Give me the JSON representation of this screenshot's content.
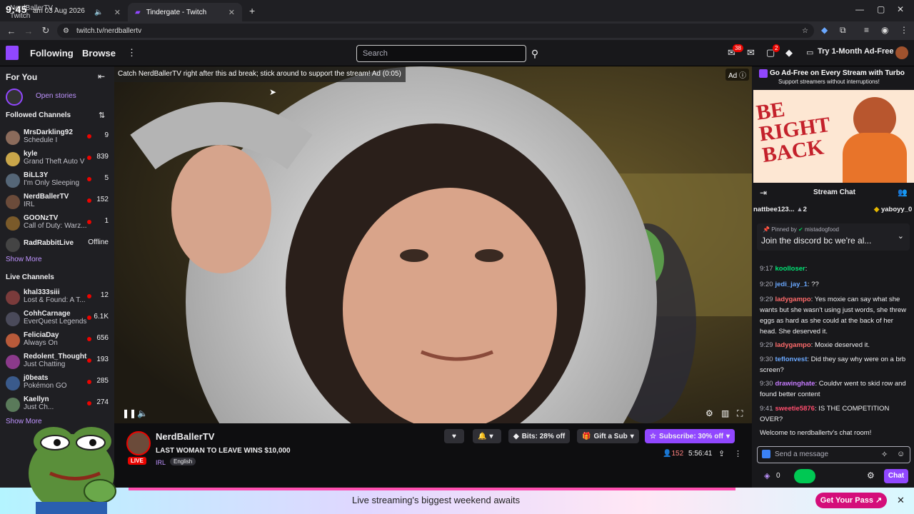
{
  "browser": {
    "clock": "9:45",
    "date": "am  03 Aug 2026",
    "tabs": [
      {
        "label": "NerdBallerTV - Twitch",
        "active": false
      },
      {
        "label": "Tindergate - Twitch",
        "active": true
      }
    ],
    "url": "twitch.tv/nerdballertv"
  },
  "nav": {
    "following": "Following",
    "browse": "Browse",
    "search_placeholder": "Search",
    "inbox_badge": "38",
    "notif_badge": "2",
    "try_turbo": "Try 1-Month Ad-Free"
  },
  "sidebar": {
    "for_you": "For You",
    "open_stories": "Open stories",
    "followed_header": "Followed Channels",
    "followed": [
      {
        "name": "MrsDarkling92",
        "game": "Schedule I",
        "viewers": "9",
        "color": "#8b6b5b"
      },
      {
        "name": "kyle",
        "game": "Grand Theft Auto V",
        "viewers": "839",
        "color": "#c9a64a"
      },
      {
        "name": "BiLL3Y",
        "game": "I'm Only Sleeping",
        "viewers": "5",
        "color": "#556677"
      },
      {
        "name": "NerdBallerTV",
        "game": "IRL",
        "viewers": "152",
        "color": "#6b4b3a"
      },
      {
        "name": "GOONzTV",
        "game": "Call of Duty: Warz...",
        "viewers": "1",
        "color": "#7a5a2a"
      },
      {
        "name": "RadRabbitLive",
        "game": "",
        "viewers": "Offline",
        "color": "#444"
      }
    ],
    "show_more_1": "Show More",
    "live_header": "Live Channels",
    "live": [
      {
        "name": "khal333siii",
        "game": "Lost & Found: A T...",
        "viewers": "12",
        "color": "#7a3b3b"
      },
      {
        "name": "CohhCarnage",
        "game": "EverQuest Legends",
        "viewers": "6.1K",
        "color": "#4a4a5a"
      },
      {
        "name": "FeliciaDay",
        "game": "Always On",
        "viewers": "656",
        "color": "#b85a3a"
      },
      {
        "name": "Redolent_Thought",
        "game": "Just Chatting",
        "viewers": "193",
        "color": "#8b3a8b"
      },
      {
        "name": "j0beats",
        "game": "Pokémon GO",
        "viewers": "285",
        "color": "#3a5a8b"
      },
      {
        "name": "Kaellyn",
        "game": "Just Ch...",
        "viewers": "274",
        "color": "#5a7a5a"
      }
    ],
    "show_more_2": "Show More"
  },
  "video": {
    "ad_banner": "Catch NerdBallerTV right after this ad break; stick around to support the stream! Ad (0:05)",
    "ad_tag": "Ad"
  },
  "stream": {
    "channel": "NerdBallerTV",
    "title": "LAST WOMAN TO LEAVE WINS $10,000",
    "live": "LIVE",
    "category": "IRL",
    "language": "English",
    "bits": "Bits: 28% off",
    "gift": "Gift a Sub",
    "subscribe": "Subscribe: 30% off",
    "viewers": "152",
    "uptime": "5:56:41"
  },
  "right": {
    "turbo_heading": "Go Ad-Free on Every Stream with Turbo",
    "turbo_sub": "Support streamers without interruptions!",
    "brb_text": "BE RIGHT BACK",
    "chat_title": "Stream Chat",
    "leaders": [
      {
        "name": "nattbee123...",
        "count": "2"
      },
      {
        "name": "yaboyy_0",
        "count": ""
      }
    ],
    "pinned_by": "Pinned by",
    "pinned_user": "mistadogfood",
    "pinned_text": "Join the discord bc we're al...",
    "messages": [
      {
        "time": "9:17",
        "user": "koolloser",
        "color": "#00e676",
        "text": ""
      },
      {
        "time": "9:20",
        "user": "jedi_jay_1",
        "color": "#6aa8ff",
        "text": "??"
      },
      {
        "time": "9:29",
        "user": "ladygampo",
        "color": "#ff6b6b",
        "text": "Yes moxie can say what she wants but she wasn't using just words, she threw eggs as hard as she could at the back of her head. She deserved it."
      },
      {
        "time": "9:29",
        "user": "ladygampo",
        "color": "#ff6b6b",
        "text": "Moxie deserved it."
      },
      {
        "time": "9:30",
        "user": "teflonvest",
        "color": "#6aa8ff",
        "text": "Did they say why were on a brb screen?"
      },
      {
        "time": "9:30",
        "user": "drawinghate",
        "color": "#c67bff",
        "text": "Couldvr went to skid row and found better content"
      },
      {
        "time": "9:41",
        "user": "sweetie5876",
        "color": "#ff4d6d",
        "text": "IS THE COMPETITION OVER?"
      }
    ],
    "welcome": "Welcome to nerdballertv's chat room!",
    "input_placeholder": "Send a message",
    "points": "0",
    "chat_button": "Chat"
  },
  "banner": {
    "text": "Live streaming's biggest weekend awaits",
    "button": "Get Your Pass"
  }
}
